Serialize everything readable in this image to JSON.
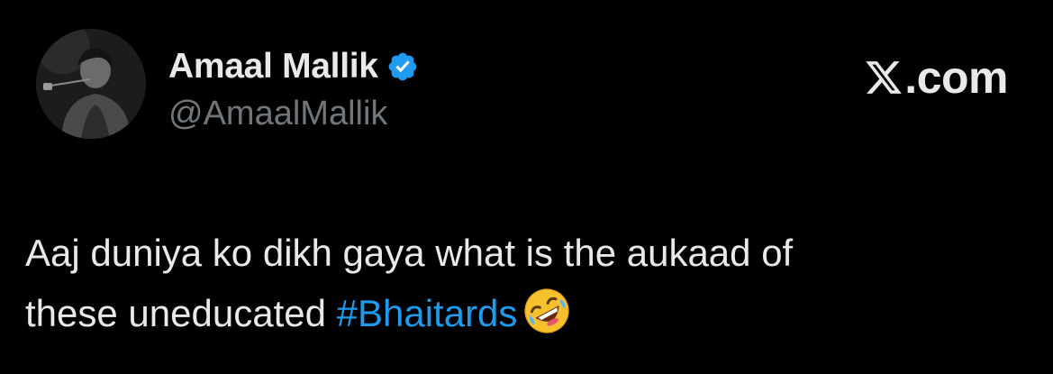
{
  "author": {
    "display_name": "Amaal Mallik",
    "handle": "@AmaalMallik",
    "verified_icon": "verified-badge-icon"
  },
  "brand": {
    "label": ".com",
    "icon": "x-logo-icon"
  },
  "tweet": {
    "line1": "Aaj duniya ko dikh gaya what is the aukaad of",
    "line2_text": "these uneducated ",
    "hashtag": "#Bhaitards",
    "emoji": "rolling-on-the-floor-laughing-emoji"
  },
  "colors": {
    "background": "#000000",
    "primary_text": "#e7e9ea",
    "secondary_text": "#71767b",
    "accent": "#1d9bf0"
  }
}
